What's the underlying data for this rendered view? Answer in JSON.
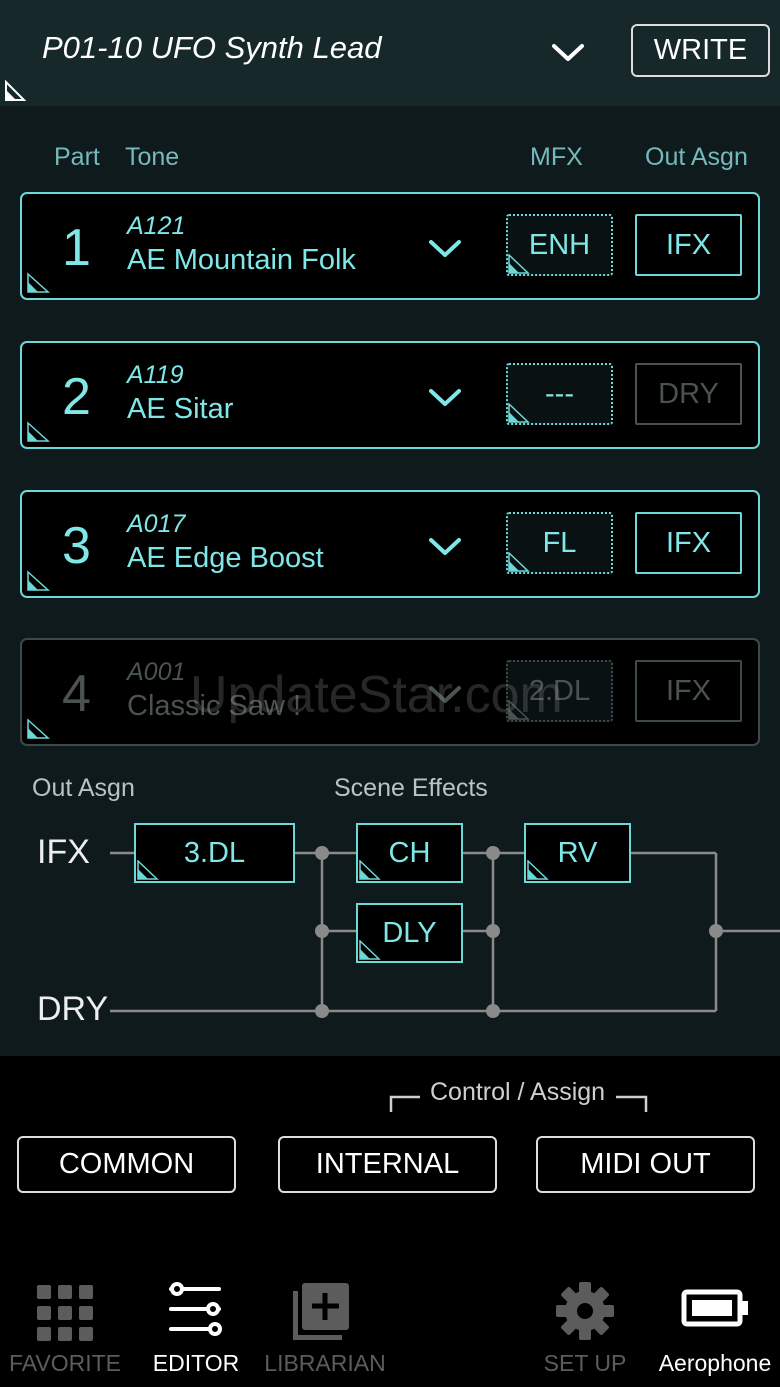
{
  "header": {
    "patch_name": "P01-10 UFO Synth Lead",
    "write_label": "WRITE"
  },
  "columns": {
    "part": "Part",
    "tone": "Tone",
    "mfx": "MFX",
    "out_asgn": "Out Asgn"
  },
  "parts": [
    {
      "number": "1",
      "code": "A121",
      "tone": "AE Mountain Folk",
      "mfx": "ENH",
      "out": "IFX"
    },
    {
      "number": "2",
      "code": "A119",
      "tone": "AE Sitar",
      "mfx": "---",
      "out": "DRY"
    },
    {
      "number": "3",
      "code": "A017",
      "tone": "AE Edge Boost",
      "mfx": "FL",
      "out": "IFX"
    },
    {
      "number": "4",
      "code": "A001",
      "tone": "Classic Saw !",
      "mfx": "2.DL",
      "out": "IFX"
    }
  ],
  "watermark": "UpdateStar.com",
  "effects": {
    "out_asgn_label": "Out Asgn",
    "scene_effects_label": "Scene Effects",
    "ifx_label": "IFX",
    "dry_label": "DRY",
    "ifx_effect": "3.DL",
    "chorus": "CH",
    "delay": "DLY",
    "reverb": "RV"
  },
  "control": {
    "group_label": "Control / Assign",
    "common": "COMMON",
    "internal": "INTERNAL",
    "midi_out": "MIDI OUT"
  },
  "nav": {
    "favorite": "FAVORITE",
    "editor": "EDITOR",
    "librarian": "LIBRARIAN",
    "setup": "SET UP",
    "aerophone": "Aerophone"
  },
  "colors": {
    "accent": "#6dd8d8",
    "header_bg": "#17282b",
    "main_bg": "#0f1a1c"
  }
}
